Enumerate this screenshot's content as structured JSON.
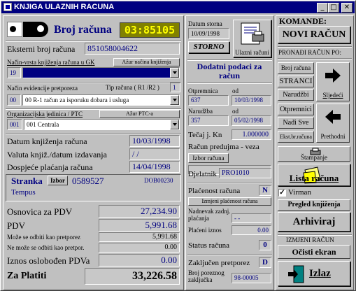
{
  "window": {
    "title": "KNJIGA ULAZNIH RACUNA",
    "minimize": "_",
    "maximize": "□",
    "close": "✕"
  },
  "invoice": {
    "broj_label": "Broj računa",
    "broj_value": "03:85105",
    "eksterni_label": "Eksterni broj računa",
    "eksterni_value": "851058004622",
    "nacin_vrsta_label": "Način-vrsta knjiženja računa u GK",
    "azur_nacina_btn": "Ažur načina knjiženja",
    "nacin_code": "19",
    "evidencija_label": "Način evidencije pretporeza",
    "tip_label": "Tip računa ( R1 /R2 )",
    "tip_value": "1",
    "evidencija_code": "00",
    "evidencija_value": "00 R-1 račun za isporuku dobara i usluga",
    "org_label": "Organizacijska jedinica / PTC",
    "azur_ptc_btn": "Ažur PTC-a",
    "org_code": "001",
    "org_value": "001 Centrala"
  },
  "dates": {
    "datum_label": "Datum knjiženja računa",
    "datum_value": "10/03/1998",
    "valuta_label": "Valuta knjiž./datum izdavanja",
    "valuta_value": "/ /",
    "dospijece_label": "Dospjeće plaćanja računa",
    "dospijece_value": "14/04/1998"
  },
  "stranka": {
    "label": "Stranka",
    "izbor_btn": "Izbor",
    "value": "0589527",
    "dob": "DOB00230",
    "name": "Tempus"
  },
  "totals": {
    "osnovica_label": "Osnovica za PDV",
    "osnovica_value": "27,234.90",
    "pdv_label": "PDV",
    "pdv_value": "5,991.68",
    "moze_label": "Može se odbiti kao pretporez",
    "moze_value": "5,991.68",
    "nemoze_label": "Ne može se odbiti kao pretpor.",
    "nemoze_value": "0.00",
    "iznos_label": "Iznos oslobođen PDVa",
    "iznos_value": "0.00",
    "platiti_label": "Za Platiti",
    "platiti_value": "33,226.58"
  },
  "middle": {
    "storno_label": "Datum storna",
    "storno_date": "10/09/1998",
    "storno_btn": "STORNO",
    "ulazni_label": "Ulazni računi",
    "dodatni_title": "Dodatni podaci za račun",
    "otpremnica_label": "Otpremnica",
    "od1_label": "od",
    "otpremnica_value": "637",
    "otpremnica_date": "10/03/1998",
    "narudzba_label": "Narudžba",
    "od2_label": "od",
    "narudzba_value": "357",
    "narudzba_date": "05/02/1998",
    "tecaj_label": "Tečaj j. Kn",
    "tecaj_value": "1.000000",
    "predujam_label": "Račun predujma - veza",
    "izbor_racuna_btn": "Izbor računa",
    "djelatnik_label": "Djelatnik",
    "djelatnik_value": "PRO1010",
    "placenost_label": "Plaćenost računa",
    "placenost_value": "N",
    "izmjeni_btn": "Izmjeni plaćenost računa",
    "nadnevak_label": "Nadnevak zadnj. plaćanja",
    "nadnevak_value": "- -",
    "placeni_label": "Plaćeni iznos",
    "placeni_value": "0.00",
    "status_label": "Status računa",
    "status_value": "0",
    "zakljucen_label": "Zaključen pretporez",
    "zakljucen_value": "D",
    "broj_porez_label": "Broj poreznog zaključka",
    "broj_porez_value": "98-00005"
  },
  "right": {
    "komande": "KOMANDE:",
    "novi_btn": "NOVI RAČUN",
    "pronadji": "PRONAĐI RAČUN PO:",
    "broj_racuna_btn": "Broj računa",
    "stranci_btn": "STRANCI",
    "narudzbi_btn": "Narudžbi",
    "otpremnici_btn": "Otpremnici",
    "nadi_sve_btn": "Nađi Sve",
    "ekst_btn": "Ekst.br.računa",
    "sljedeci": "Sljedeći",
    "prethodni": "Prethodni",
    "stampanje_btn": "Štampanje",
    "lista_btn": "Lista računa",
    "virman_label": "Virman",
    "pregled_btn": "Pregled knjiženja",
    "arhiviraj_btn": "Arhiviraj",
    "izmjeni_racun": "IZMJENI RAČUN",
    "ocisti_btn": "Očisti ekran",
    "izlaz_btn": "Izlaz"
  }
}
